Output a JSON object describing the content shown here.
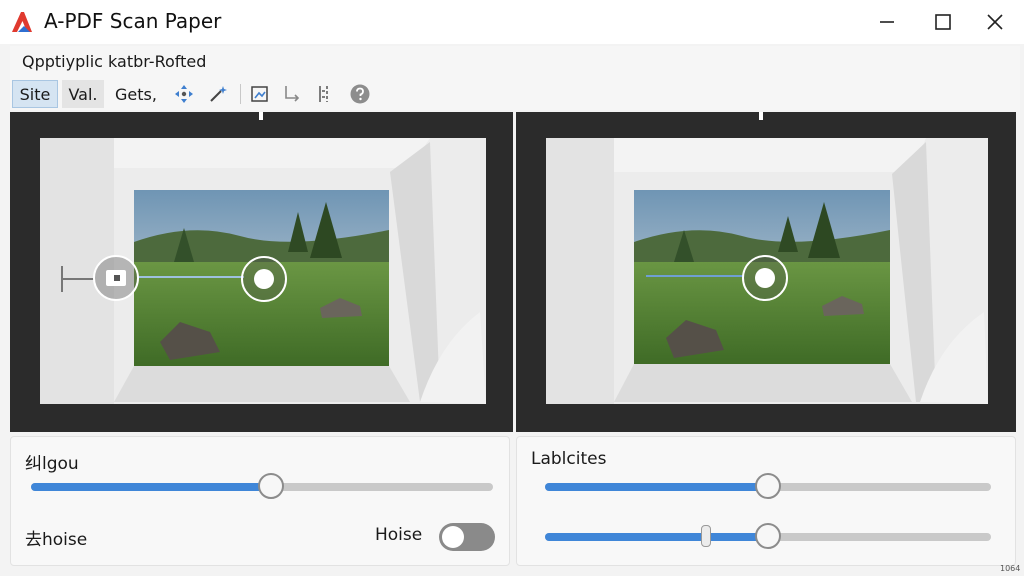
{
  "window": {
    "title": "A-PDF Scan Paper",
    "subtitle": "Qpptiyplic katbr-Rofted"
  },
  "toolbar": {
    "site_label": "Site",
    "val_label": "Val.",
    "gets_label": "Gets,",
    "icons": [
      "move-arrows-icon",
      "magic-wand-icon",
      "crop-icon",
      "return-arrow-icon",
      "split-icon",
      "help-icon"
    ]
  },
  "panels": {
    "left": {
      "label": "纠lgou",
      "slider_value": 0.52,
      "noise_label": "去hoise",
      "toggle_label": "Hoise",
      "toggle_on": false
    },
    "right": {
      "label": "Lablcites",
      "slider1_value": 0.5,
      "slider2_value": 0.5,
      "slider2_marker": 0.36
    }
  },
  "footer": {
    "corner_text": "1064"
  },
  "colors": {
    "accent": "#3f86d8",
    "logo_red": "#e03a2f",
    "logo_blue": "#2f6fd1"
  }
}
